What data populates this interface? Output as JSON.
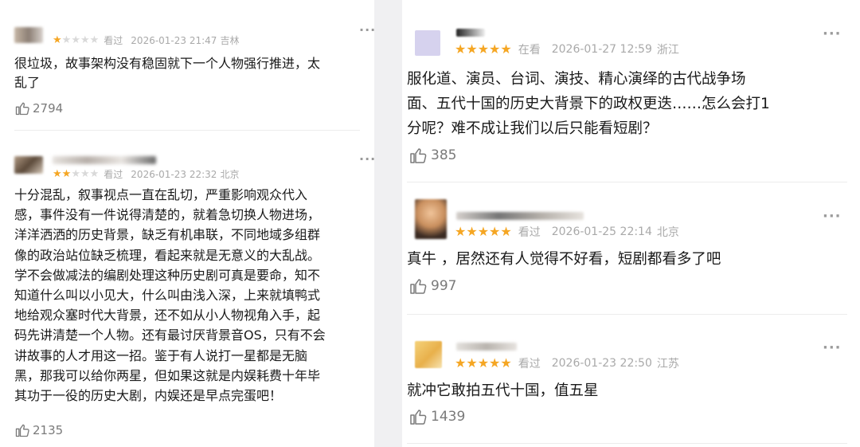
{
  "colors": {
    "star_on": "#f5a623",
    "star_off": "#d9d9d9",
    "meta_gray": "#a9a9a9",
    "text": "#1a1a1a",
    "like_gray": "#7a7a7a"
  },
  "left_reviews": [
    {
      "rating": 1,
      "status": "看过",
      "time": "2026-01-23 21:47",
      "location": "吉林",
      "lines": [
        "很垃圾，故事架构没有稳固就下一个人物强行推进，太",
        "乱了"
      ],
      "likes": "2794"
    },
    {
      "rating": 2,
      "status": "看过",
      "time": "2026-01-23 22:32",
      "location": "北京",
      "lines": [
        "十分混乱，叙事视点一直在乱切，严重影响观众代入",
        "感，事件没有一件说得清楚的，就着急切换人物进场，",
        "洋洋洒洒的历史背景，缺乏有机串联，不同地域多组群",
        "像的政治站位缺乏梳理，看起来就是无意义的大乱战。",
        "学不会做减法的编剧处理这种历史剧可真是要命，知不",
        "知道什么叫以小见大，什么叫由浅入深，上来就填鸭式",
        "地给观众塞时代大背景，还不如从小人物视角入手，起",
        "码先讲清楚一个人物。还有最讨厌背景音OS，只有不会",
        "讲故事的人才用这一招。鉴于有人说打一星都是无脑",
        "黑，那我可以给你两星，但如果这就是内娱耗费十年毕",
        "其功于一役的历史大剧，内娱还是早点完蛋吧！"
      ],
      "likes": "2135"
    }
  ],
  "right_reviews": [
    {
      "rating": 5,
      "status": "在看",
      "time": "2026-01-27 12:59",
      "location": "浙江",
      "lines": [
        "服化道、演员、台词、演技、精心演绎的古代战争场",
        "面、五代十国的历史大背景下的政权更迭……怎么会打1",
        "分呢？难不成让我们以后只能看短剧？"
      ],
      "likes": "385"
    },
    {
      "rating": 5,
      "status": "看过",
      "time": "2026-01-25 22:14",
      "location": "北京",
      "lines": [
        "真牛 ，居然还有人觉得不好看，短剧都看多了吧"
      ],
      "likes": "997"
    },
    {
      "rating": 5,
      "status": "看过",
      "time": "2026-01-23 22:50",
      "location": "江苏",
      "lines": [
        "就冲它敢拍五代十国，值五星"
      ],
      "likes": "1439"
    }
  ],
  "icons": {
    "more": "more-dots-icon",
    "like": "thumbs-up-icon",
    "star": "star-icon"
  }
}
